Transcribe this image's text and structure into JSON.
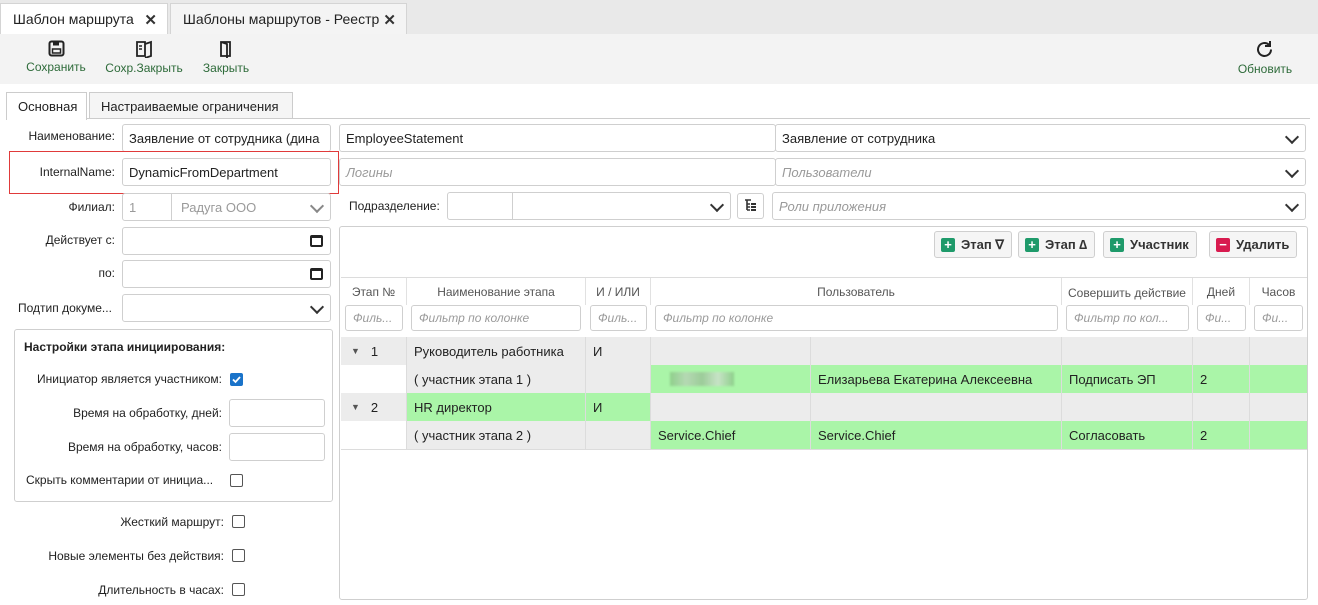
{
  "tabs": [
    {
      "label": "Шаблон маршрута",
      "active": true
    },
    {
      "label": "Шаблоны маршрутов - Реестр",
      "active": false
    }
  ],
  "toolbar": {
    "save": "Сохранить",
    "save_close": "Сохр.Закрыть",
    "close": "Закрыть",
    "refresh": "Обновить"
  },
  "inner_tabs": [
    "Основная",
    "Настраиваемые ограничения"
  ],
  "form": {
    "name_label": "Наименование:",
    "name_value": "Заявление от сотрудника (дина",
    "name_code": "EmployeeStatement",
    "name_type": "Заявление от сотрудника",
    "internal_label": "InternalName:",
    "internal_value": "DynamicFromDepartment",
    "logins_placeholder": "Логины",
    "users_placeholder": "Пользователи",
    "branch_label": "Филиал:",
    "branch_code": "1",
    "branch_name": "Радуга ООО",
    "dept_label": "Подразделение:",
    "roles_placeholder": "Роли приложения",
    "valid_from_label": "Действует с:",
    "valid_to_label": "по:",
    "subtype_label": "Подтип докуме..."
  },
  "init_settings": {
    "title": "Настройки этапа инициирования:",
    "initiator_label": "Инициатор является участником:",
    "initiator_checked": true,
    "days_label": "Время на обработку, дней:",
    "hours_label": "Время на обработку, часов:",
    "hide_comments_label": "Скрыть комментарии от инициа...",
    "hide_comments_checked": false
  },
  "options": [
    {
      "label": "Жесткий маршрут:",
      "checked": false
    },
    {
      "label": "Новые элементы без действия:",
      "checked": false
    },
    {
      "label": "Длительность в часах:",
      "checked": false
    }
  ],
  "grid_buttons": {
    "stage_down": "Этап ∇",
    "stage_up": "Этап ∆",
    "participant": "Участник",
    "delete": "Удалить"
  },
  "grid": {
    "columns": [
      "Этап №",
      "Наименование этапа",
      "И / ИЛИ",
      "Пользователь",
      "Совершить действие",
      "Дней",
      "Часов"
    ],
    "filters": [
      "Филь...",
      "Фильтр по колонке",
      "Филь...",
      "Фильтр по колонке",
      "Фильтр по кол...",
      "Фи...",
      "Фи..."
    ],
    "rows": [
      {
        "kind": "stage",
        "num": "1",
        "name": "Руководитель работника",
        "andor": "И",
        "login": "",
        "user": "",
        "action": "",
        "days": "",
        "hours": ""
      },
      {
        "kind": "member",
        "num": "",
        "name": "( участник этапа 1 )",
        "andor": "",
        "login": "",
        "user": "Елизарьева Екатерина Алексеевна",
        "action": "Подписать ЭП",
        "days": "2",
        "hours": ""
      },
      {
        "kind": "stage",
        "num": "2",
        "name": "HR директор",
        "andor": "И",
        "login": "",
        "user": "",
        "action": "",
        "days": "",
        "hours": ""
      },
      {
        "kind": "member",
        "num": "",
        "name": "( участник этапа 2 )",
        "andor": "",
        "login": "Service.Chief",
        "user": "Service.Chief",
        "action": "Согласовать",
        "days": "2",
        "hours": ""
      }
    ]
  },
  "colors": {
    "accent_green": "#2e6b3a",
    "row_green": "#aaf5a8",
    "highlight_red": "#e03a3a",
    "delete_red": "#d81b4f",
    "add_green": "#1e9a6a"
  }
}
